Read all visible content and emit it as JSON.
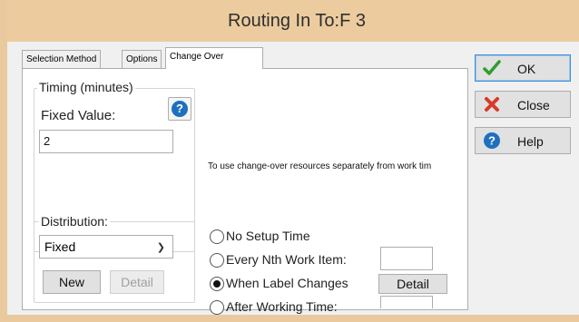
{
  "window": {
    "title": "Routing In To:F 3"
  },
  "tabs": [
    {
      "label": "Selection Method"
    },
    {
      "label": "Options"
    },
    {
      "label": "Change Over"
    }
  ],
  "timing": {
    "group_label": "Timing (minutes)",
    "fixed_value_label": "Fixed Value:",
    "fixed_value": "2",
    "help_glyph": "?"
  },
  "distribution": {
    "group_label": "Distribution:",
    "selected": "Fixed",
    "new_label": "New",
    "detail_label": "Detail"
  },
  "info_text": "To use change-over resources separately from work tim",
  "changeover": {
    "options": [
      {
        "label": "No Setup Time",
        "checked": false
      },
      {
        "label": "Every Nth Work Item:",
        "checked": false
      },
      {
        "label": "When Label Changes",
        "checked": true
      },
      {
        "label": "After Working Time:",
        "checked": false
      }
    ],
    "nth_value": "",
    "working_time_value": "",
    "detail_label": "Detail"
  },
  "side_buttons": {
    "ok_label": "OK",
    "close_label": "Close",
    "help_label": "Help"
  },
  "icons": {
    "ok": "check-icon",
    "close": "red-x-icon",
    "help": "help-icon",
    "dropdown": "chevron-down-icon"
  },
  "colors": {
    "title_bar": "#eccc9f",
    "check_green": "#2e9e2e",
    "close_red": "#d83a2a",
    "help_blue": "#1f6fbf"
  }
}
